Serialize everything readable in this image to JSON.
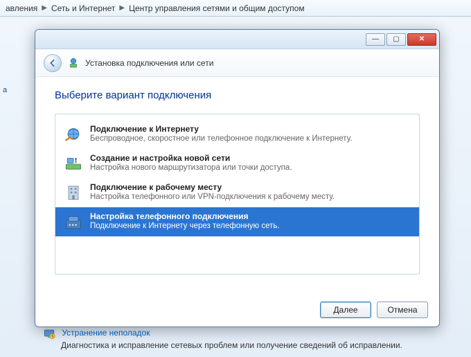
{
  "breadcrumb": {
    "seg1": "авления",
    "seg2": "Сеть и Интернет",
    "seg3": "Центр управления сетями и общим доступом"
  },
  "bg_sidebar_letter": "а",
  "dialog": {
    "wizard_title": "Установка подключения или сети",
    "heading": "Выберите вариант подключения",
    "options": [
      {
        "title": "Подключение к Интернету",
        "desc": "Беспроводное, скоростное или телефонное подключение к Интернету."
      },
      {
        "title": "Создание и настройка новой сети",
        "desc": "Настройка нового маршрутизатора или точки доступа."
      },
      {
        "title": "Подключение к рабочему месту",
        "desc": "Настройка телефонного или VPN-подключения к рабочему месту."
      },
      {
        "title": "Настройка телефонного подключения",
        "desc": "Подключение к Интернету через телефонную сеть."
      }
    ],
    "buttons": {
      "next": "Далее",
      "cancel": "Отмена"
    },
    "win_min": "—",
    "win_max": "▢",
    "win_close": "✕"
  },
  "troubleshoot": {
    "title": "Устранение неполадок",
    "desc": "Диагностика и исправление сетевых проблем или получение сведений об исправлении."
  }
}
